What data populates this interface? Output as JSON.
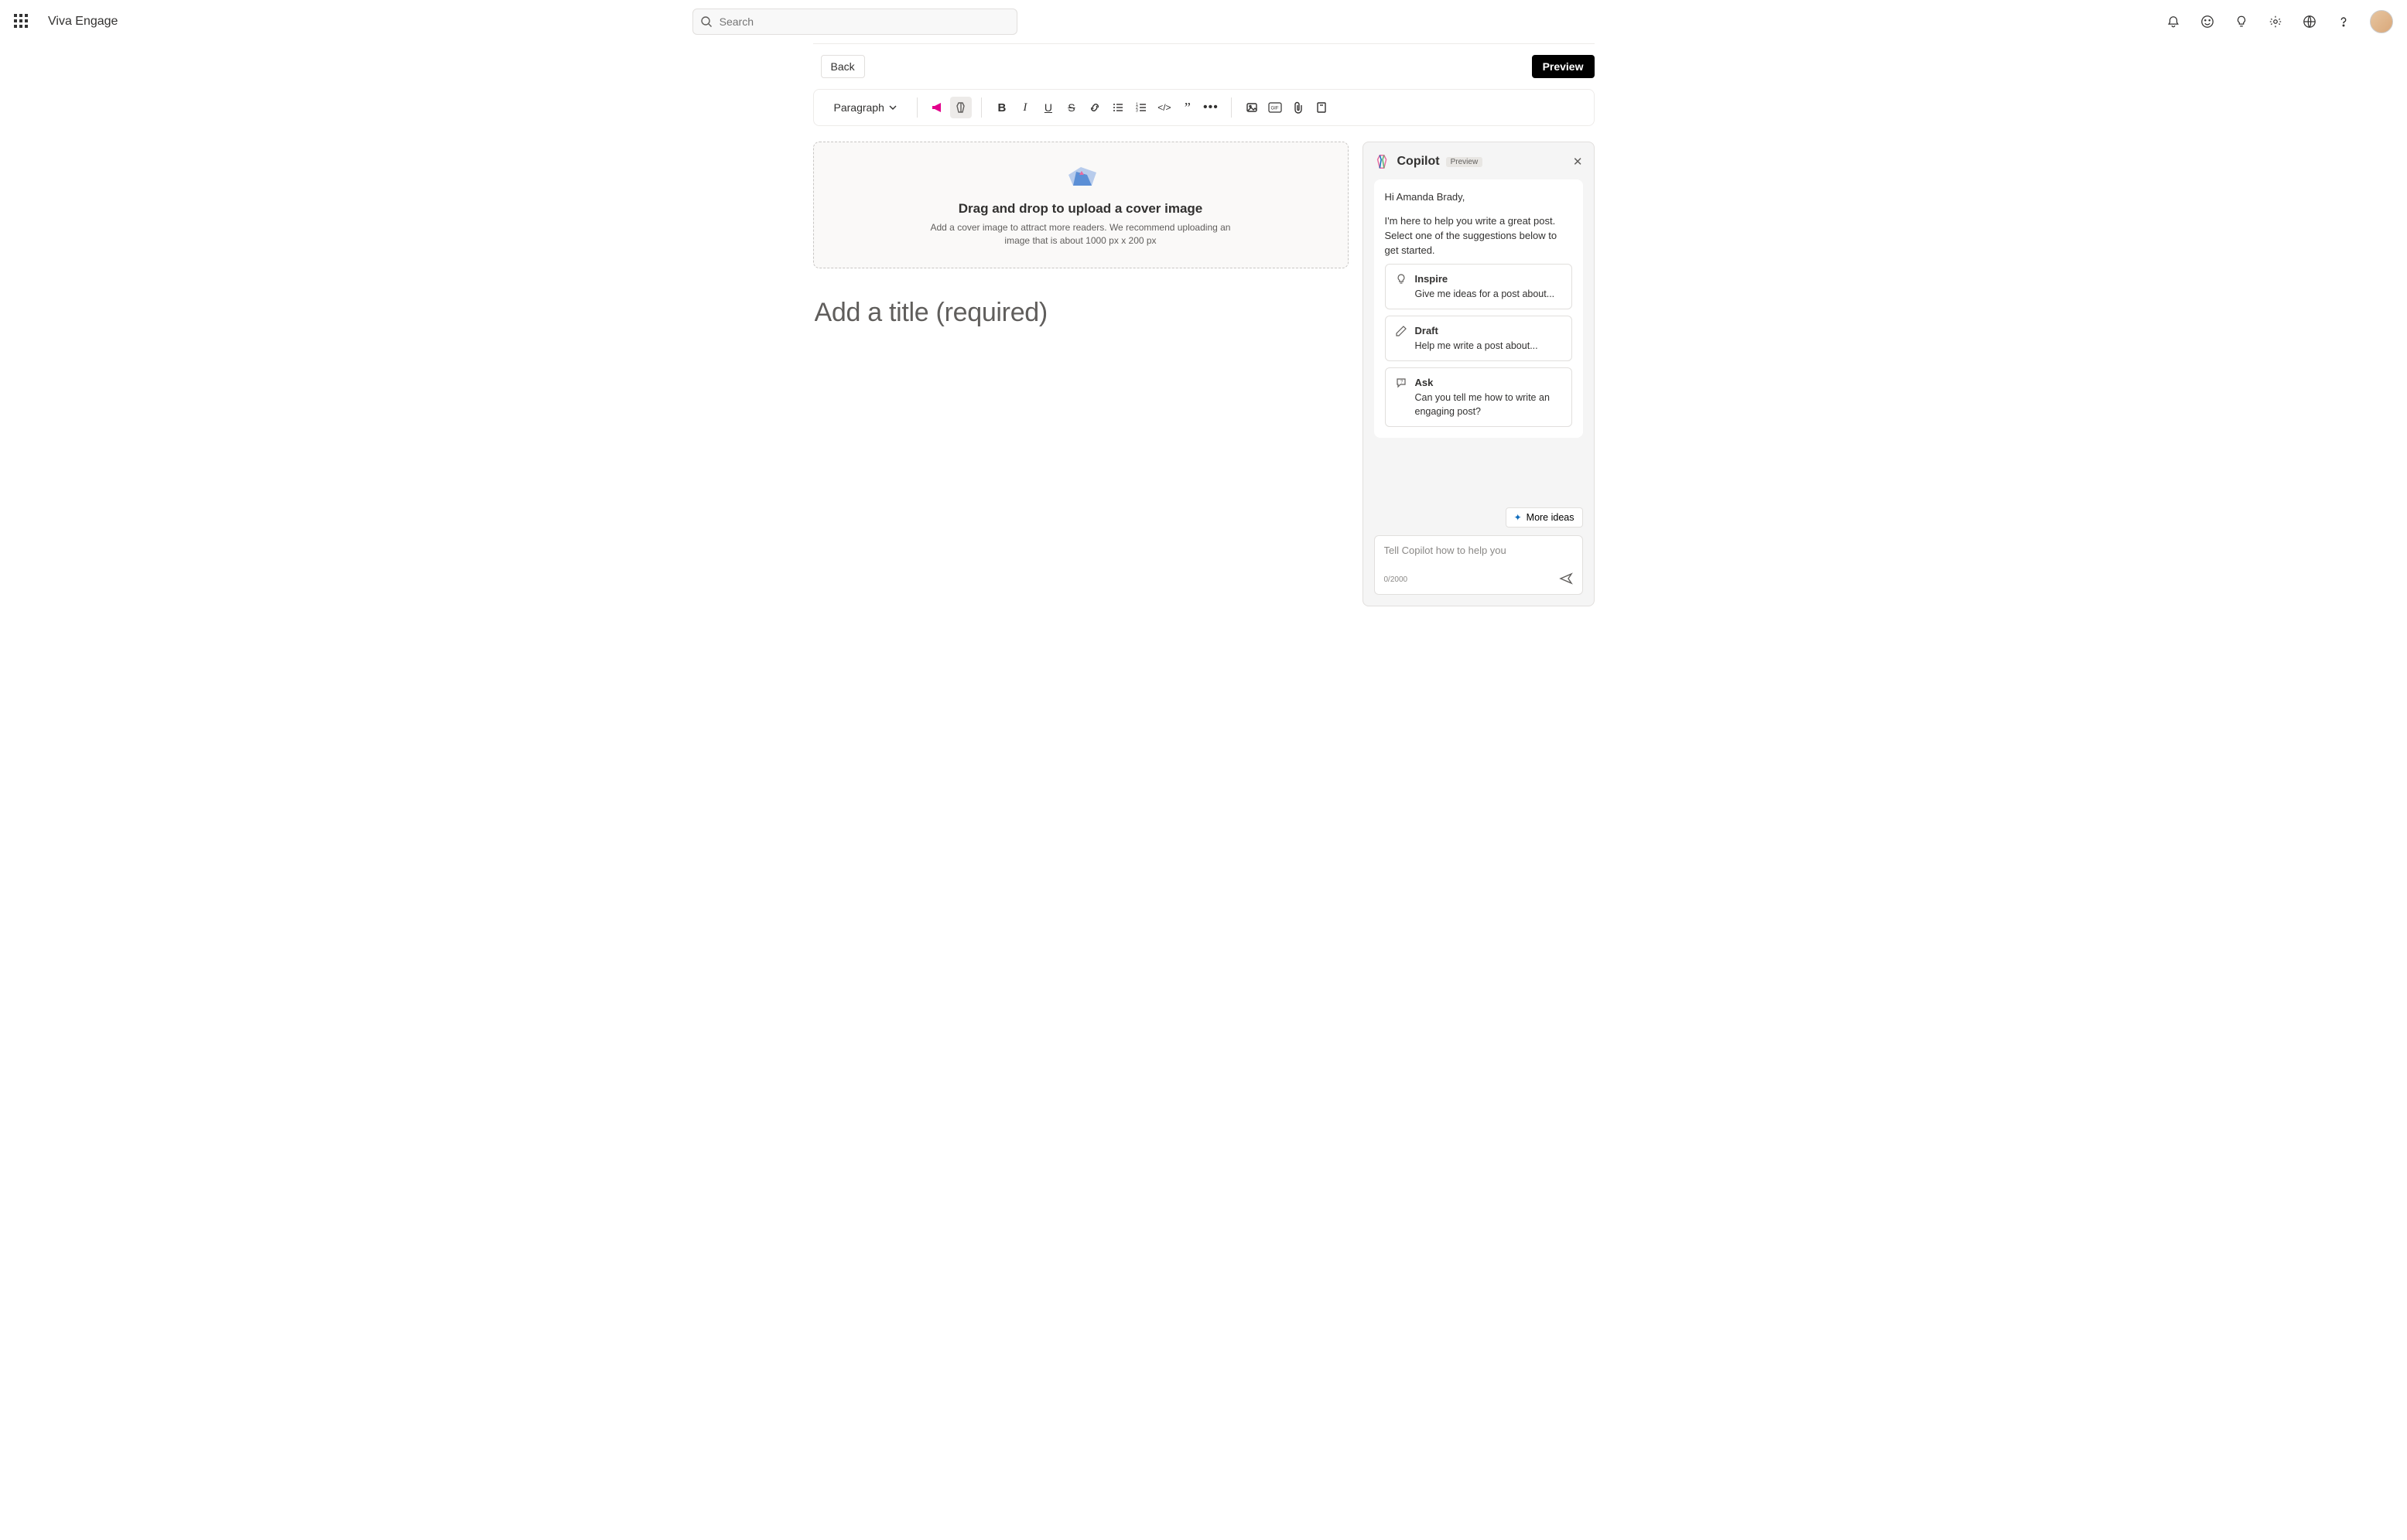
{
  "header": {
    "brand": "Viva Engage",
    "search_placeholder": "Search"
  },
  "actions": {
    "back": "Back",
    "preview": "Preview"
  },
  "toolbar": {
    "style_select": "Paragraph"
  },
  "dropzone": {
    "title": "Drag and drop to upload a cover image",
    "subtitle": "Add a cover image to attract more readers. We recommend uploading an image that is about 1000 px x 200 px"
  },
  "editor": {
    "title_placeholder": "Add a title (required)"
  },
  "copilot": {
    "title": "Copilot",
    "badge": "Preview",
    "greeting": "Hi Amanda Brady,",
    "intro": "I'm here to help you write a great post. Select one of the suggestions below to get started.",
    "suggestions": [
      {
        "title": "Inspire",
        "sub": "Give me ideas for a post about..."
      },
      {
        "title": "Draft",
        "sub": "Help me write a post about..."
      },
      {
        "title": "Ask",
        "sub": "Can you tell me how to write an engaging post?"
      }
    ],
    "more_ideas": "More ideas",
    "input_placeholder": "Tell Copilot how to help you",
    "counter": "0/2000"
  }
}
